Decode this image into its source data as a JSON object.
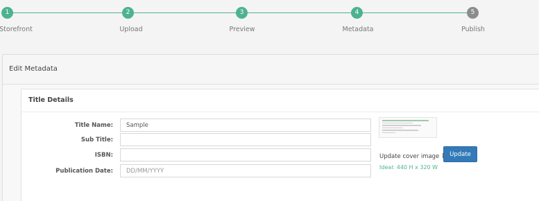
{
  "stepper": {
    "steps": [
      {
        "number": "1",
        "label": "Storefront",
        "state": "complete"
      },
      {
        "number": "2",
        "label": "Upload",
        "state": "complete"
      },
      {
        "number": "3",
        "label": "Preview",
        "state": "complete"
      },
      {
        "number": "4",
        "label": "Metadata",
        "state": "current"
      },
      {
        "number": "5",
        "label": "Publish",
        "state": "pending"
      }
    ]
  },
  "panel": {
    "title": "Edit Metadata"
  },
  "card": {
    "title": "Title Details",
    "fields": {
      "title_name": {
        "label": "Title Name:",
        "value": "Sample",
        "placeholder": ""
      },
      "sub_title": {
        "label": "Sub Title:",
        "value": "",
        "placeholder": ""
      },
      "isbn": {
        "label": "ISBN:",
        "value": "",
        "placeholder": ""
      },
      "publication_date": {
        "label": "Publication Date:",
        "value": "",
        "placeholder": "DD/MM/YYYY"
      }
    },
    "cover": {
      "update_text": "Update cover image",
      "update_button": "Update",
      "ideal_text": "Ideal: 440 H x 320 W",
      "edit_icon": "edit-icon"
    }
  },
  "colors": {
    "accent_green": "#4db38f",
    "pending_gray": "#8c8c8c",
    "button_blue": "#337ab7"
  }
}
